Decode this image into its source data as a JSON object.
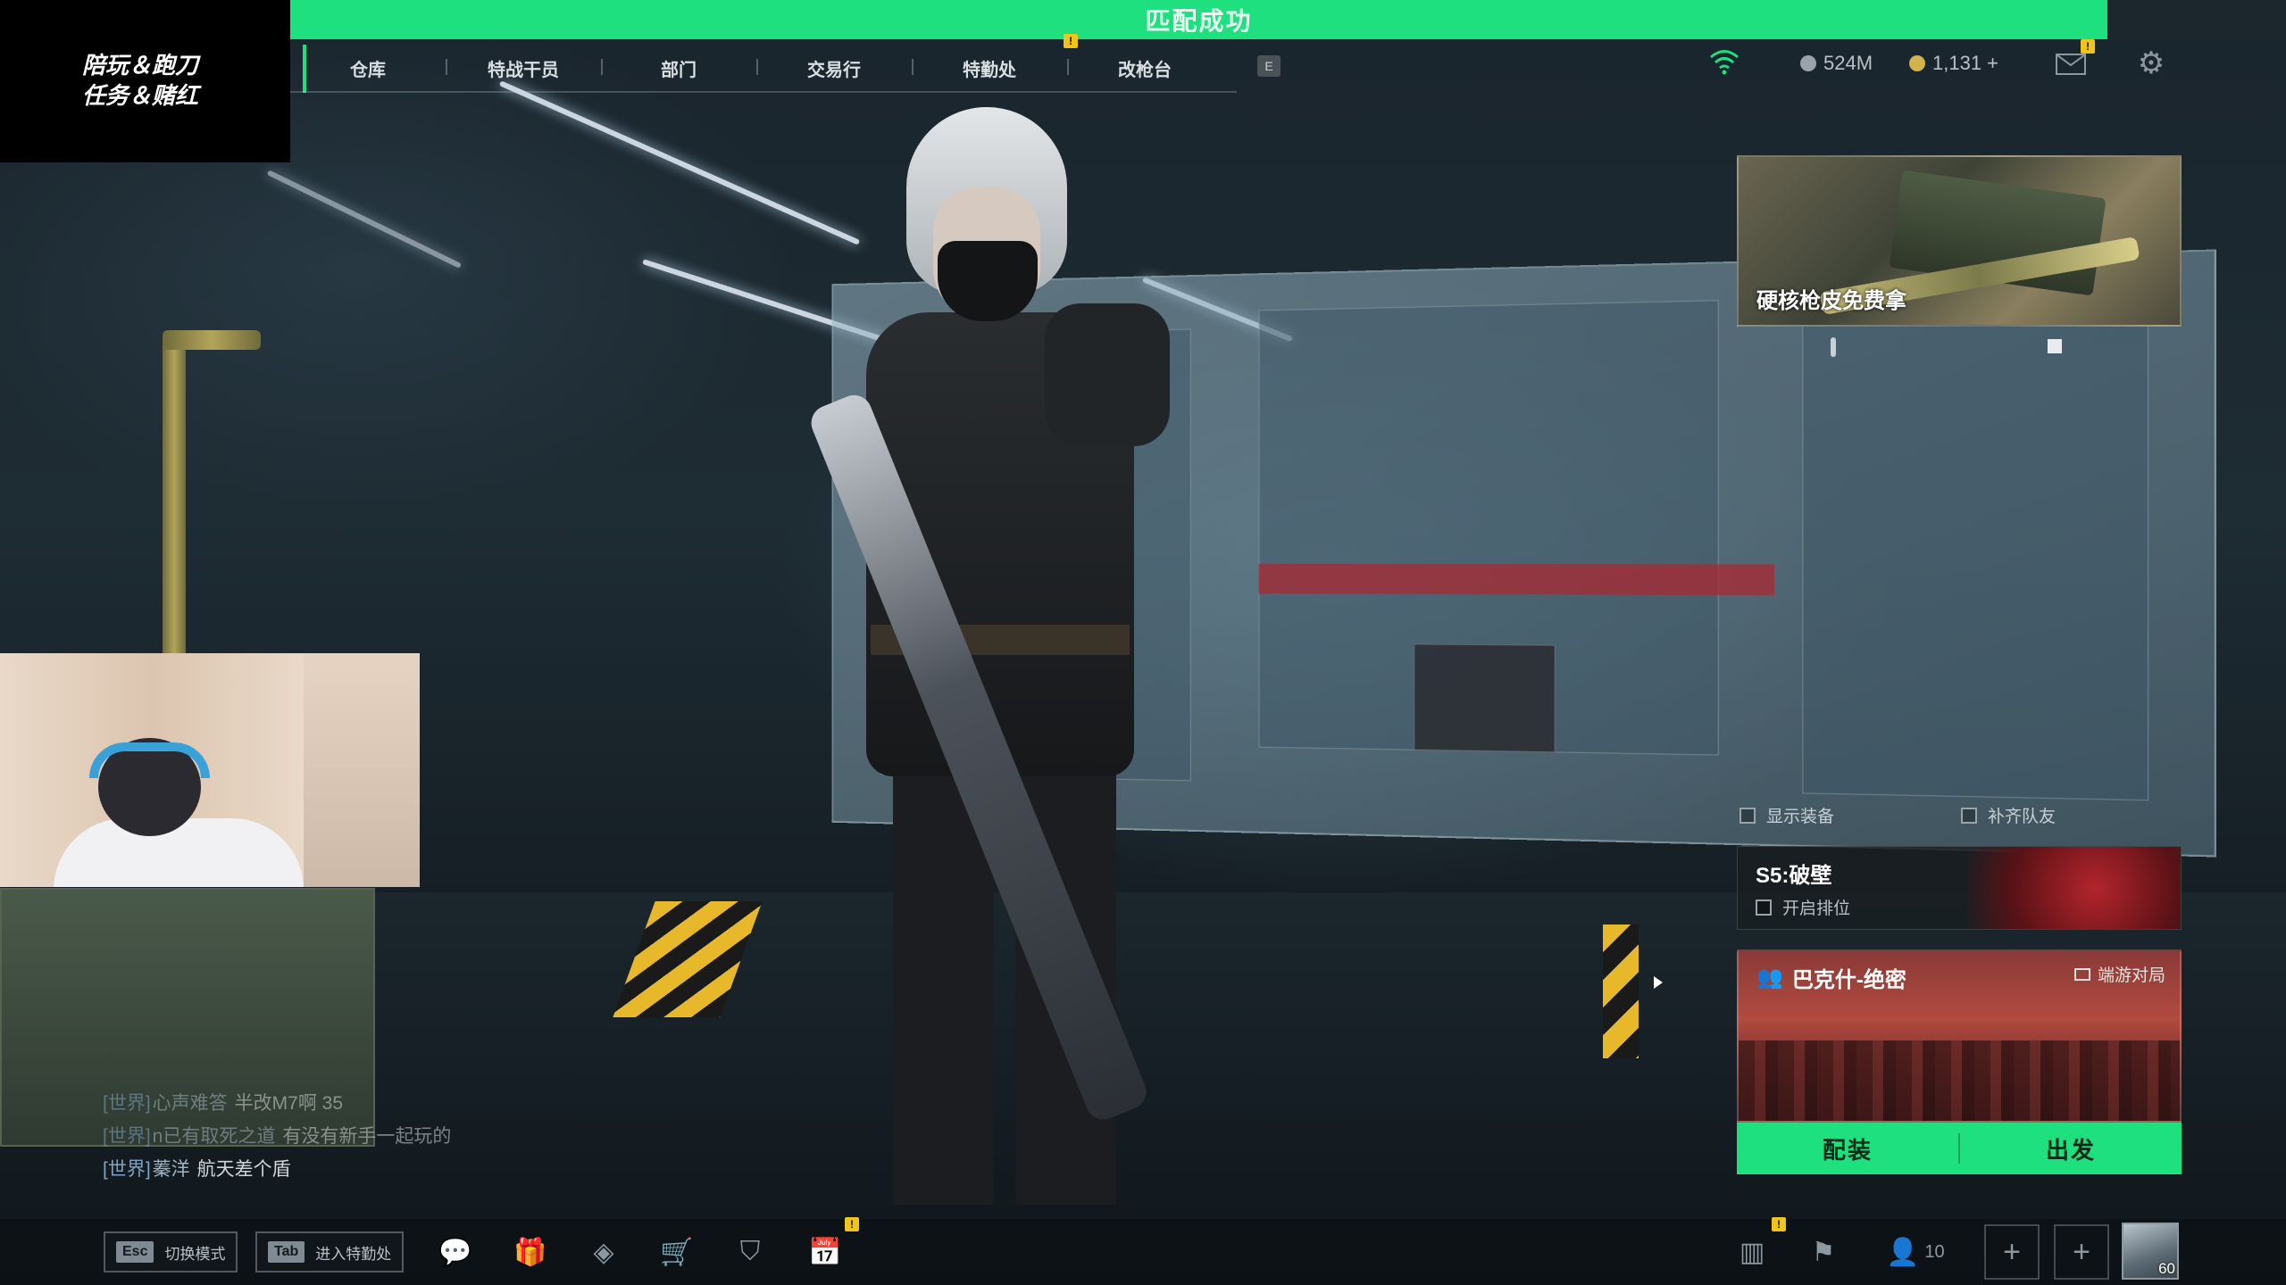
{
  "banner": {
    "text": "匹配成功"
  },
  "stream_overlay": {
    "line1": "陪玩＆跑刀",
    "line2": "任务＆赌红"
  },
  "nav": {
    "items": [
      "仓库",
      "特战干员",
      "部门",
      "交易行",
      "特勤处",
      "改枪台"
    ],
    "key_hint": "E"
  },
  "status": {
    "currency1": "524M",
    "currency2": "1,131 +",
    "colors": {
      "currency1": "#9aa3a9",
      "currency2": "#d4b24a",
      "wifi": "#1ee07f"
    }
  },
  "promo": {
    "title": "硬核枪皮免费拿"
  },
  "toggles": {
    "show_gear": "显示装备",
    "fill_team": "补齐队友"
  },
  "season": {
    "title": "S5:破壁",
    "rank_label": "开启排位"
  },
  "map": {
    "name": "巴克什-绝密",
    "mode": "端游对局"
  },
  "actions": {
    "loadout": "配装",
    "depart": "出发"
  },
  "chat": [
    {
      "channel": "[世界]",
      "user": "心声难答",
      "msg": "半改M7啊  35",
      "faded": true
    },
    {
      "channel": "[世界]",
      "user": "n已有取死之道",
      "msg": "有没有新手一起玩的",
      "faded": true
    },
    {
      "channel": "[世界]",
      "user": "蓁洋",
      "msg": "航天差个盾",
      "faded": false
    }
  ],
  "bottom": {
    "hotkey1": {
      "key": "Esc",
      "label": "切换模式"
    },
    "hotkey2": {
      "key": "Tab",
      "label": "进入特勤处"
    },
    "team_count": "10",
    "avatar_level": "60"
  },
  "theme": {
    "accent": "#1ee07f",
    "alert": "#f0c419"
  }
}
